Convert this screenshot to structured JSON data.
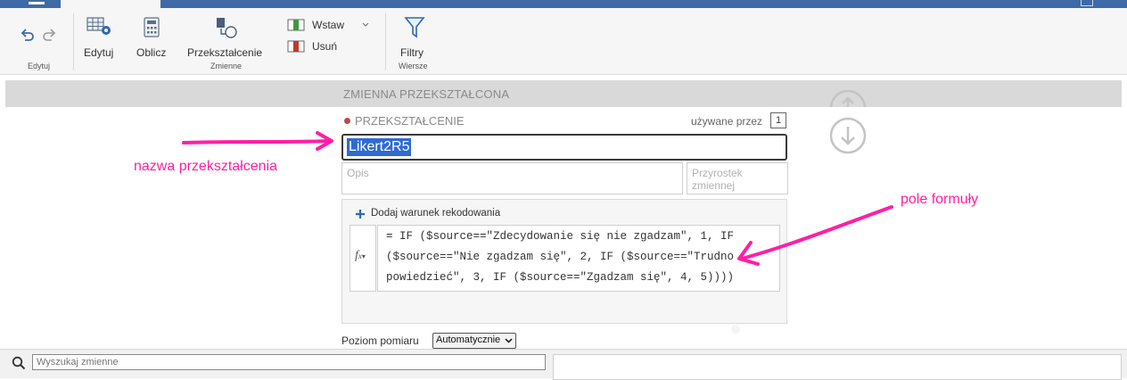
{
  "ribbon": {
    "edit_label": "Edytuj",
    "compute_label": "Oblicz",
    "transform_label": "Przekształcenie",
    "insert_label": "Wstaw",
    "delete_label": "Usuń",
    "filters_label": "Filtry",
    "group_edit": "Edytuj",
    "group_variables": "Zmienne",
    "group_rows": "Wiersze"
  },
  "section": {
    "title": "ZMIENNA PRZEKSZTAŁCONA"
  },
  "transform": {
    "header": "PRZEKSZTAŁCENIE",
    "used_by_label": "używane przez",
    "used_by_count": "1",
    "name_value": "Likert2R5",
    "description_placeholder": "Opis",
    "increment_placeholder_line1": "Przyrostek",
    "increment_placeholder_line2": "zmiennej",
    "add_condition_label": "Dodaj warunek rekodowania",
    "formula_line1": "= IF ($source==\"Zdecydowanie się nie zgadzam\", 1, IF",
    "formula_line2": "($source==\"Nie zgadzam się\", 2, IF ($source==\"Trudno",
    "formula_line3": "powiedzieć\", 3, IF ($source==\"Zgadzam się\", 4, 5))))",
    "measure_label": "Poziom pomiaru",
    "measure_value": "Automatycznie"
  },
  "annotations": {
    "name_note": "nazwa przekształcenia",
    "formula_note": "pole formuły",
    "color": "#ff1fa5"
  },
  "search": {
    "placeholder": "Wyszukaj zmienne"
  }
}
